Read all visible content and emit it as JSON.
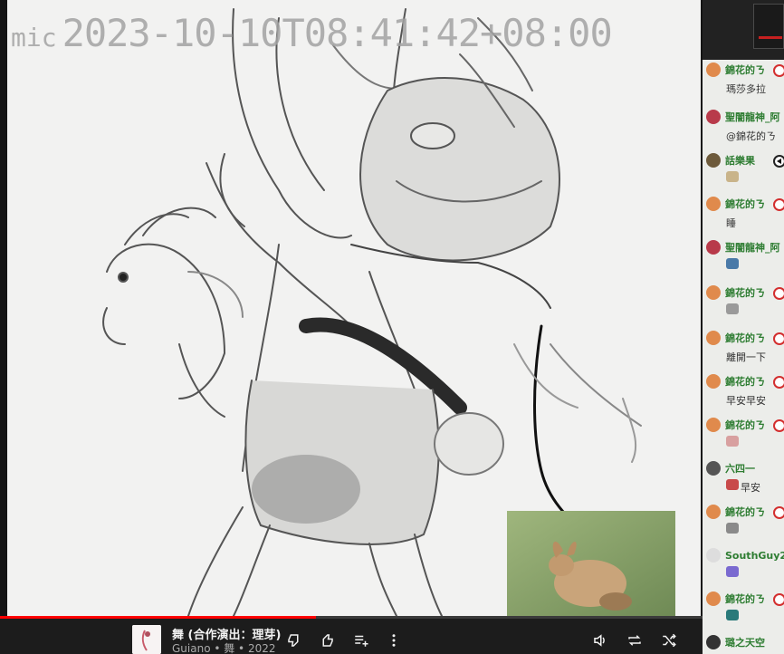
{
  "stream": {
    "timestamp_mic": "mic",
    "timestamp_date": "2023-10-10T08:41:42+08:00"
  },
  "chat": {
    "messages": [
      {
        "author": "錦花的ㄋ",
        "text": "瑪莎多拉",
        "avatar_color": "#e08a4c",
        "badge": "member"
      },
      {
        "author": "聖闇龍神_阿",
        "text": "@錦花的ㄋ",
        "avatar_color": "#b83a4a",
        "badge": "none"
      },
      {
        "author": "話樂果",
        "text": "",
        "emote_color": "#c9b48a",
        "avatar_color": "#6d5a3b",
        "badge": "speaker"
      },
      {
        "author": "錦花的ㄋ",
        "text": "睡",
        "avatar_color": "#e08a4c",
        "badge": "member"
      },
      {
        "author": "聖闇龍神_阿",
        "text": "",
        "emote_color": "#4a7aa8",
        "avatar_color": "#b83a4a",
        "badge": "none"
      },
      {
        "author": "錦花的ㄋ",
        "text": "",
        "emote_color": "#9a9a9a",
        "avatar_color": "#e08a4c",
        "badge": "member"
      },
      {
        "author": "錦花的ㄋ",
        "text": "離開一下",
        "avatar_color": "#e08a4c",
        "badge": "member"
      },
      {
        "author": "錦花的ㄋ",
        "text": "早安早安",
        "avatar_color": "#e08a4c",
        "badge": "member"
      },
      {
        "author": "錦花的ㄋ",
        "text": "",
        "emote_color": "#d8a0a0",
        "avatar_color": "#e08a4c",
        "badge": "member"
      },
      {
        "author": "六四一",
        "text": "早安",
        "emote_color": "#c84a4a",
        "avatar_color": "#555555",
        "badge": "none"
      },
      {
        "author": "錦花的ㄋ",
        "text": "",
        "emote_color": "#8a8a8a",
        "avatar_color": "#e08a4c",
        "badge": "member"
      },
      {
        "author": "SouthGuy2",
        "text": "",
        "emote_color": "#7a6ad0",
        "avatar_color": "#dddddd",
        "badge": "none"
      },
      {
        "author": "錦花的ㄋ",
        "text": "",
        "emote_color": "#2a7a7a",
        "avatar_color": "#e08a4c",
        "badge": "member"
      },
      {
        "author": "璐之天空",
        "text": "",
        "avatar_color": "#333333",
        "badge": "none"
      }
    ]
  },
  "player": {
    "progress_percent": 45,
    "song_title": "舞 (合作演出：理芽)",
    "song_subtitle": "Guiano • 舞 • 2022",
    "buttons": {
      "dislike": "thumbs-down-icon",
      "like": "thumbs-up-icon",
      "add_to_queue": "playlist-add-icon",
      "more": "more-vert-icon",
      "volume": "volume-icon",
      "repeat": "repeat-icon",
      "shuffle": "shuffle-icon"
    }
  },
  "colors": {
    "accent_red": "#ff0000",
    "chat_author_green": "#2e7d32",
    "player_bg": "#1c1c1c",
    "canvas_bg": "#f2f2f1"
  }
}
